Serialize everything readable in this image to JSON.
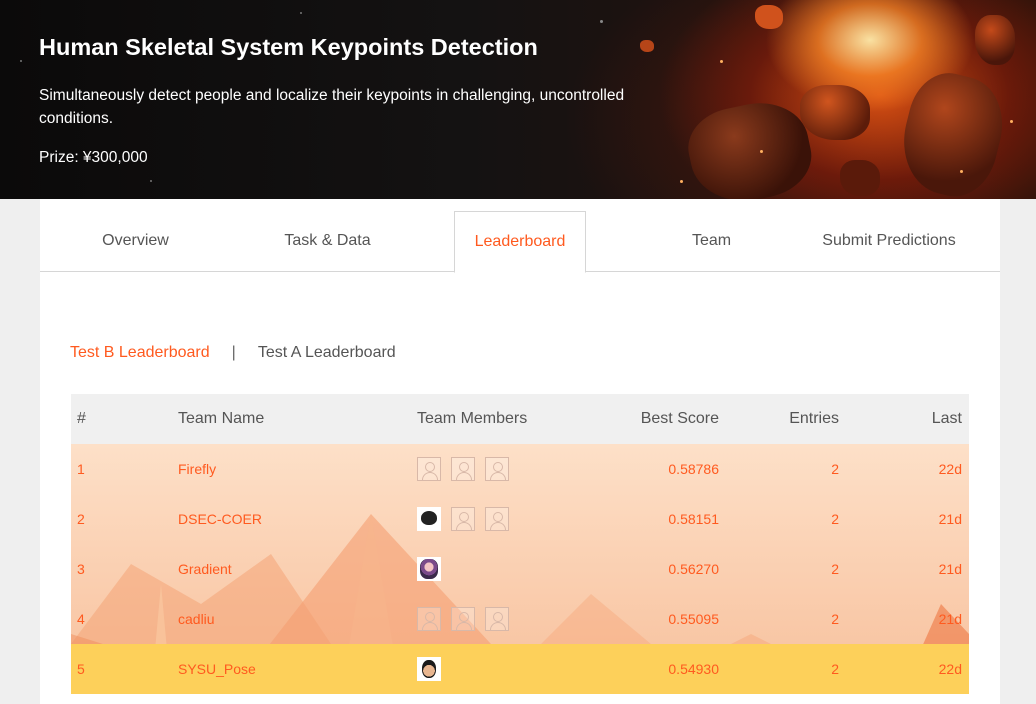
{
  "hero": {
    "title": "Human Skeletal System Keypoints Detection",
    "description": "Simultaneously detect people and localize their keypoints in challenging, uncontrolled conditions.",
    "prize": "Prize: ¥300,000"
  },
  "tabs": [
    {
      "label": "Overview"
    },
    {
      "label": "Task & Data"
    },
    {
      "label": "Leaderboard",
      "active": true
    },
    {
      "label": "Team"
    },
    {
      "label": "Submit Predictions"
    }
  ],
  "subtabs": {
    "test_b": "Test B Leaderboard",
    "separator": "|",
    "test_a": "Test A Leaderboard",
    "active": "test_b"
  },
  "table": {
    "headers": {
      "rank": "#",
      "team_name": "Team Name",
      "team_members": "Team Members",
      "best_score": "Best Score",
      "entries": "Entries",
      "last": "Last"
    },
    "rows": [
      {
        "rank": "1",
        "team_name": "Firefly",
        "members": [
          "placeholder",
          "placeholder",
          "placeholder"
        ],
        "best_score": "0.58786",
        "entries": "2",
        "last": "22d"
      },
      {
        "rank": "2",
        "team_name": "DSEC-COER",
        "members": [
          "photo-dark",
          "placeholder",
          "placeholder"
        ],
        "best_score": "0.58151",
        "entries": "2",
        "last": "21d"
      },
      {
        "rank": "3",
        "team_name": "Gradient",
        "members": [
          "photo-girl"
        ],
        "best_score": "0.56270",
        "entries": "2",
        "last": "21d"
      },
      {
        "rank": "4",
        "team_name": "cadliu",
        "members": [
          "placeholder",
          "placeholder",
          "placeholder"
        ],
        "best_score": "0.55095",
        "entries": "2",
        "last": "21d"
      },
      {
        "rank": "5",
        "team_name": "SYSU_Pose",
        "members": [
          "photo-face"
        ],
        "best_score": "0.54930",
        "entries": "2",
        "last": "22d",
        "highlight": true
      }
    ]
  },
  "colors": {
    "accent": "#ff5a1f",
    "highlight_row": "#fdd05a",
    "panel": "#ffffff",
    "page_bg": "#efefef"
  }
}
